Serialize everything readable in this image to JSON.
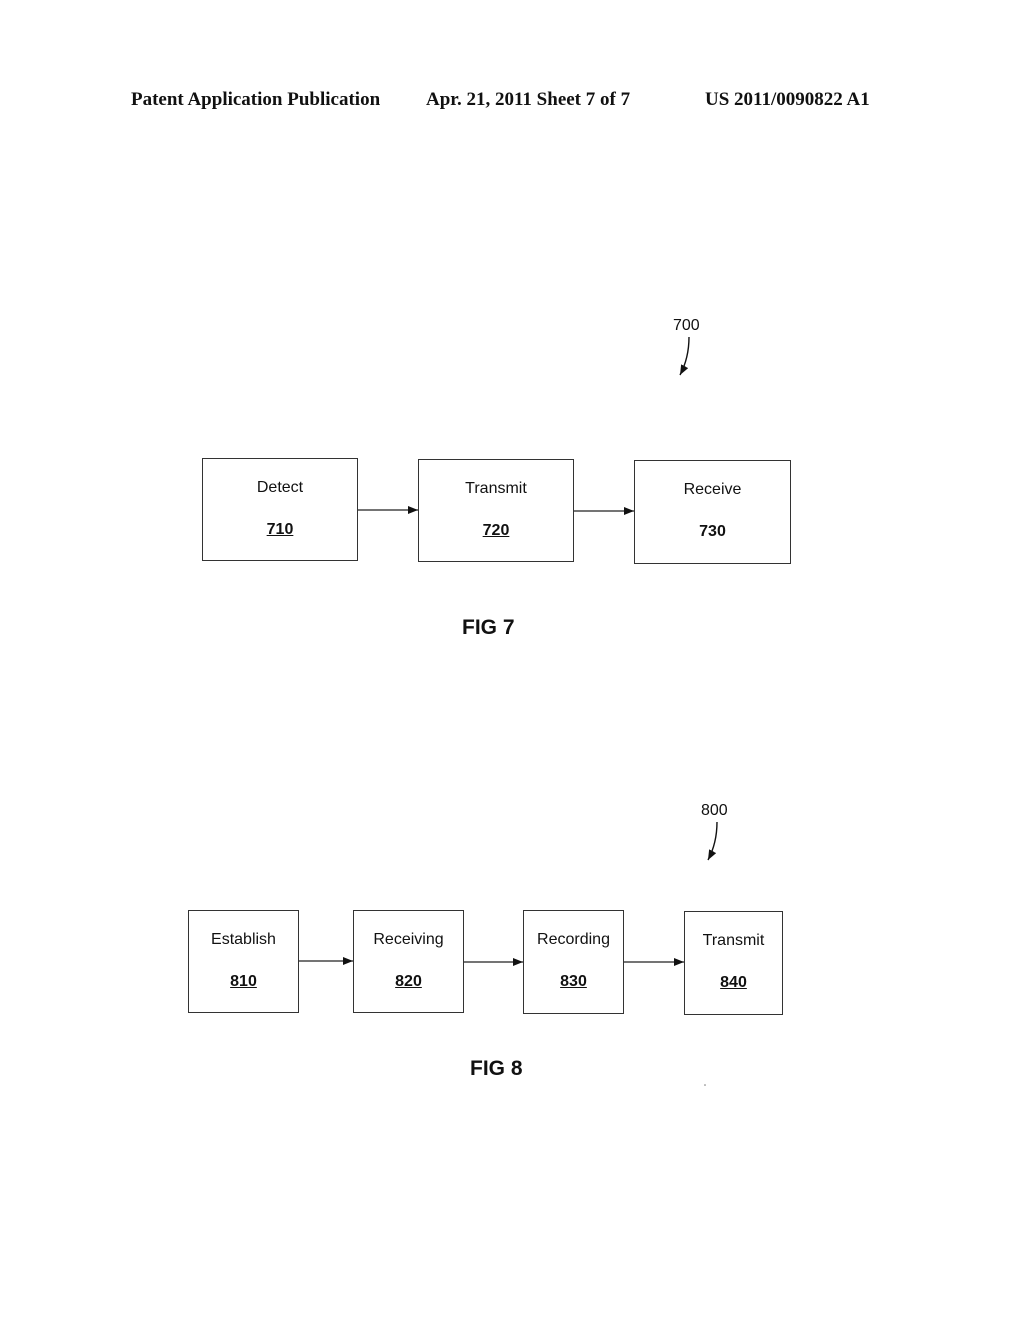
{
  "header": {
    "left": "Patent Application Publication",
    "center": "Apr. 21, 2011  Sheet 7 of 7",
    "right": "US 2011/0090822 A1"
  },
  "fig7": {
    "reference": "700",
    "caption": "FIG 7",
    "steps": [
      {
        "label": "Detect",
        "number": "710",
        "underlined": true
      },
      {
        "label": "Transmit",
        "number": "720",
        "underlined": true
      },
      {
        "label": "Receive",
        "number": "730",
        "underlined": false
      }
    ]
  },
  "fig8": {
    "reference": "800",
    "caption": "FIG 8",
    "steps": [
      {
        "label": "Establish",
        "number": "810",
        "underlined": true
      },
      {
        "label": "Receiving",
        "number": "820",
        "underlined": true
      },
      {
        "label": "Recording",
        "number": "830",
        "underlined": true
      },
      {
        "label": "Transmit",
        "number": "840",
        "underlined": true
      }
    ]
  }
}
